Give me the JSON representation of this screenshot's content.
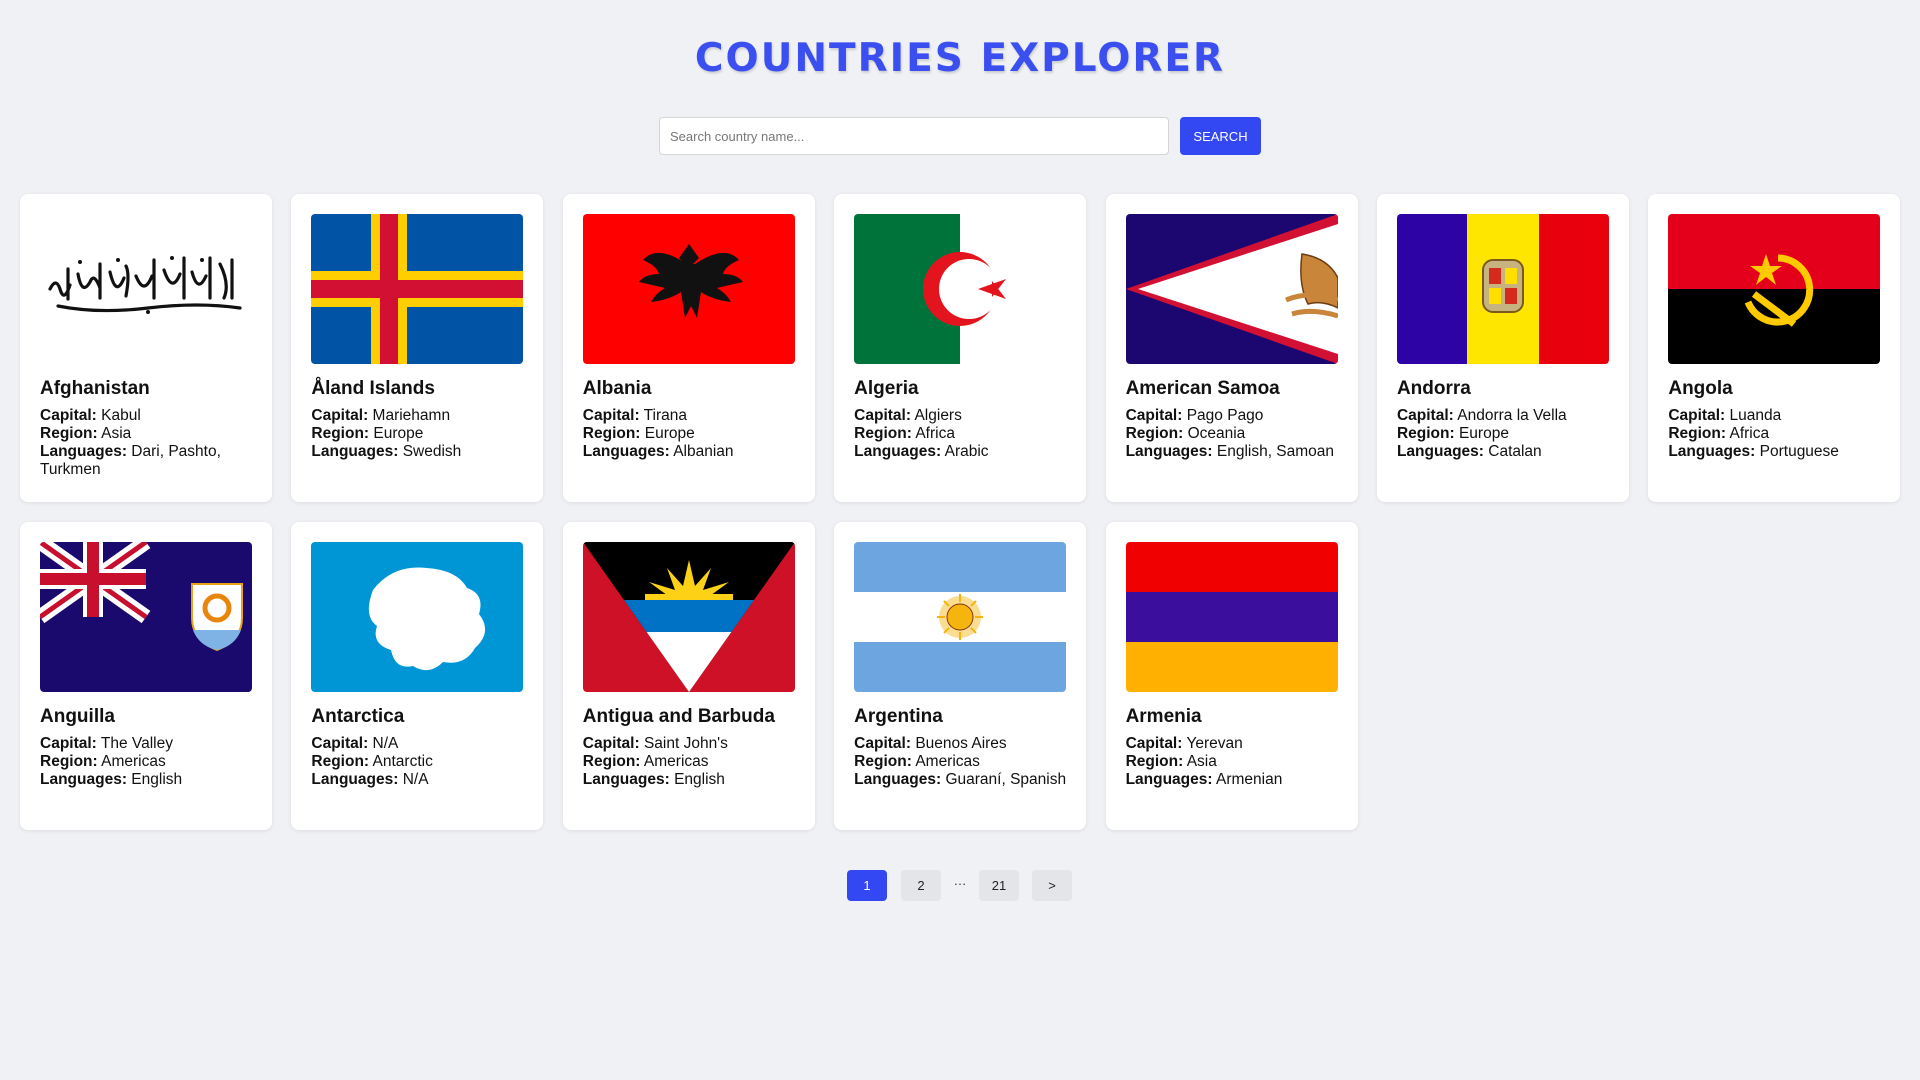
{
  "header": {
    "title": "COUNTRIES EXPLORER"
  },
  "search": {
    "placeholder": "Search country name...",
    "button_label": "SEARCH"
  },
  "labels": {
    "capital": "Capital:",
    "region": "Region:",
    "languages": "Languages:"
  },
  "countries": [
    {
      "name": "Afghanistan",
      "capital": "Kabul",
      "region": "Asia",
      "languages": "Dari, Pashto, Turkmen",
      "flag_icon": "afghanistan-flag-icon"
    },
    {
      "name": "Åland Islands",
      "capital": "Mariehamn",
      "region": "Europe",
      "languages": "Swedish",
      "flag_icon": "aland-islands-flag-icon"
    },
    {
      "name": "Albania",
      "capital": "Tirana",
      "region": "Europe",
      "languages": "Albanian",
      "flag_icon": "albania-flag-icon"
    },
    {
      "name": "Algeria",
      "capital": "Algiers",
      "region": "Africa",
      "languages": "Arabic",
      "flag_icon": "algeria-flag-icon"
    },
    {
      "name": "American Samoa",
      "capital": "Pago Pago",
      "region": "Oceania",
      "languages": "English, Samoan",
      "flag_icon": "american-samoa-flag-icon"
    },
    {
      "name": "Andorra",
      "capital": "Andorra la Vella",
      "region": "Europe",
      "languages": "Catalan",
      "flag_icon": "andorra-flag-icon"
    },
    {
      "name": "Angola",
      "capital": "Luanda",
      "region": "Africa",
      "languages": "Portuguese",
      "flag_icon": "angola-flag-icon"
    },
    {
      "name": "Anguilla",
      "capital": "The Valley",
      "region": "Americas",
      "languages": "English",
      "flag_icon": "anguilla-flag-icon"
    },
    {
      "name": "Antarctica",
      "capital": "N/A",
      "region": "Antarctic",
      "languages": "N/A",
      "flag_icon": "antarctica-flag-icon"
    },
    {
      "name": "Antigua and Barbuda",
      "capital": "Saint John's",
      "region": "Americas",
      "languages": "English",
      "flag_icon": "antigua-and-barbuda-flag-icon"
    },
    {
      "name": "Argentina",
      "capital": "Buenos Aires",
      "region": "Americas",
      "languages": "Guaraní, Spanish",
      "flag_icon": "argentina-flag-icon"
    },
    {
      "name": "Armenia",
      "capital": "Yerevan",
      "region": "Asia",
      "languages": "Armenian",
      "flag_icon": "armenia-flag-icon"
    }
  ],
  "pagination": {
    "pages": [
      "1",
      "2",
      "…",
      "21"
    ],
    "current": "1",
    "next_label": ">"
  },
  "colors": {
    "accent": "#3347f2",
    "title": "#3b4ff0",
    "background": "#f0f1f5"
  }
}
